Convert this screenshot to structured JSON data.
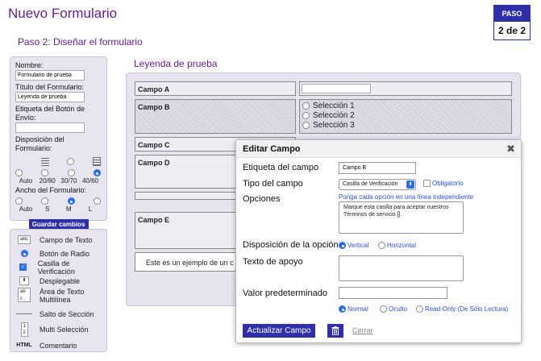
{
  "app": {
    "title": "Nuevo Formulario",
    "subtitle": "Paso 2: Diseñar el formulario"
  },
  "step": {
    "label": "PASO",
    "value": "2 de 2"
  },
  "settings": {
    "name_label": "Nombre:",
    "name_value": "Formulario de prueba",
    "form_title_label": "Título del Formulario:",
    "form_title_value": "Leyenda de prueba",
    "send_label": "Etiqueta del Botón de Envío:",
    "send_value": "",
    "layout_label": "Disposición del Formulario:",
    "layout_options": [
      "Auto",
      "20/80",
      "30/70",
      "40/60"
    ],
    "layout_selected": "40/60",
    "width_label": "Ancho del Formulario:",
    "width_options": [
      "Auto",
      "S",
      "M",
      "L"
    ],
    "width_selected": "M",
    "save_label": "Guardar cambios"
  },
  "palette": {
    "items": [
      {
        "label": "Campo de Texto",
        "icon": "text-field-icon",
        "glyph": "abc"
      },
      {
        "label": "Botón de Radio",
        "icon": "radio-icon"
      },
      {
        "label": "Casilla de Verificación",
        "icon": "checkbox-icon"
      },
      {
        "label": "Desplegable",
        "icon": "dropdown-icon"
      },
      {
        "label": "Área de Texto Multilínea",
        "icon": "textarea-icon",
        "glyph": "ab c"
      },
      {
        "label": "Salto de Sección",
        "icon": "section-break-icon"
      },
      {
        "label": "Multi Selección",
        "icon": "multi-select-icon",
        "glyph": "1 2"
      },
      {
        "label": "Comentario",
        "icon": "comment-icon",
        "glyph": "HTML"
      }
    ]
  },
  "form": {
    "legend": "Leyenda de prueba",
    "field_a": "Campo A",
    "field_b": "Campo B",
    "field_c": "Campo C",
    "field_d": "Campo D",
    "field_e": "Campo E",
    "options": [
      "Selección 1",
      "Selección 2",
      "Selección 3"
    ],
    "example": "Este es un ejemplo de un c"
  },
  "dialog": {
    "title": "Editar Campo",
    "close": "✖",
    "label_label": "Etiqueta del campo",
    "label_value": "Campo B",
    "type_label": "Tipo del campo",
    "type_value": "Casilla de Verificación",
    "required_label": "Obligatorio",
    "options_label": "Opciones",
    "options_hint": "Ponga cada opción en una línea independiente",
    "options_value": "Marque esta casilla para aceptar nuestros Términos de servicio [].",
    "layout_label": "Disposición de la opción",
    "layout_vertical": "Vertical",
    "layout_horizontal": "Horizontal",
    "help_label": "Texto de apoyo",
    "default_label": "Valor predeterminado",
    "vis_normal": "Normal",
    "vis_hidden": "Oculto",
    "vis_readonly": "Read-Only (De Sólo Lectura)",
    "update_label": "Actualizar Campo",
    "cancel_label": "Cerrar"
  }
}
